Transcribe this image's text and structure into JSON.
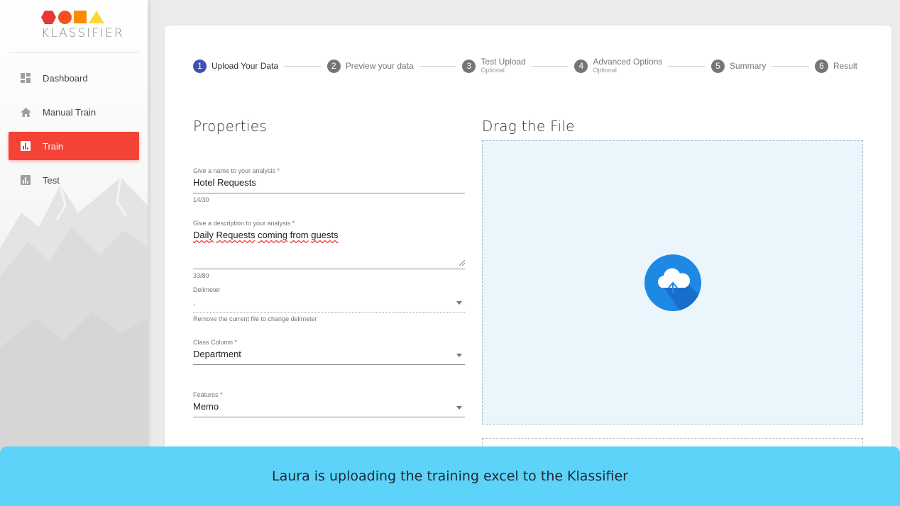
{
  "app": {
    "logo_text": "KLASSIFIER",
    "logo_colors": {
      "hexagon": "#e53935",
      "circle": "#f4511e",
      "square": "#fb8c00",
      "triangle": "#fdd835"
    }
  },
  "sidebar": {
    "items": [
      {
        "label": "Dashboard",
        "icon": "dashboard-icon",
        "active": false
      },
      {
        "label": "Manual Train",
        "icon": "home-icon",
        "active": false
      },
      {
        "label": "Train",
        "icon": "bar-chart-icon",
        "active": true
      },
      {
        "label": "Test",
        "icon": "bar-chart-icon",
        "active": false
      }
    ]
  },
  "stepper": {
    "steps": [
      {
        "number": "1",
        "label": "Upload Your Data",
        "sub": "",
        "active": true
      },
      {
        "number": "2",
        "label": "Preview your data",
        "sub": "",
        "active": false
      },
      {
        "number": "3",
        "label": "Test Upload",
        "sub": "Optional",
        "active": false
      },
      {
        "number": "4",
        "label": "Advanced Options",
        "sub": "Optional",
        "active": false
      },
      {
        "number": "5",
        "label": "Summary",
        "sub": "",
        "active": false
      },
      {
        "number": "6",
        "label": "Result",
        "sub": "",
        "active": false
      }
    ]
  },
  "properties": {
    "title": "Properties",
    "name_field": {
      "label": "Give a name to your analysis *",
      "value": "Hotel Requests",
      "counter": "14/30"
    },
    "description_field": {
      "label": "Give a description to your analysis *",
      "words": [
        "Daily",
        "Requests",
        "coming",
        "from",
        "guests"
      ],
      "counter": "33/80"
    },
    "delimiter_field": {
      "label": "Delimeter",
      "value": ",",
      "hint": "Remove the current file to change delimeter"
    },
    "class_column_field": {
      "label": "Class Column *",
      "value": "Department"
    },
    "features_field": {
      "label": "Features *",
      "value": "Memo"
    }
  },
  "upload": {
    "title": "Drag the File",
    "icon": "cloud-upload-icon",
    "accent": "#1e88e5"
  },
  "colors": {
    "active_nav": "#f44336",
    "active_step": "#3f51b5",
    "caption_bg": "#5dd3f9"
  },
  "caption": {
    "text": "Laura is uploading the training excel to the Klassifier"
  }
}
